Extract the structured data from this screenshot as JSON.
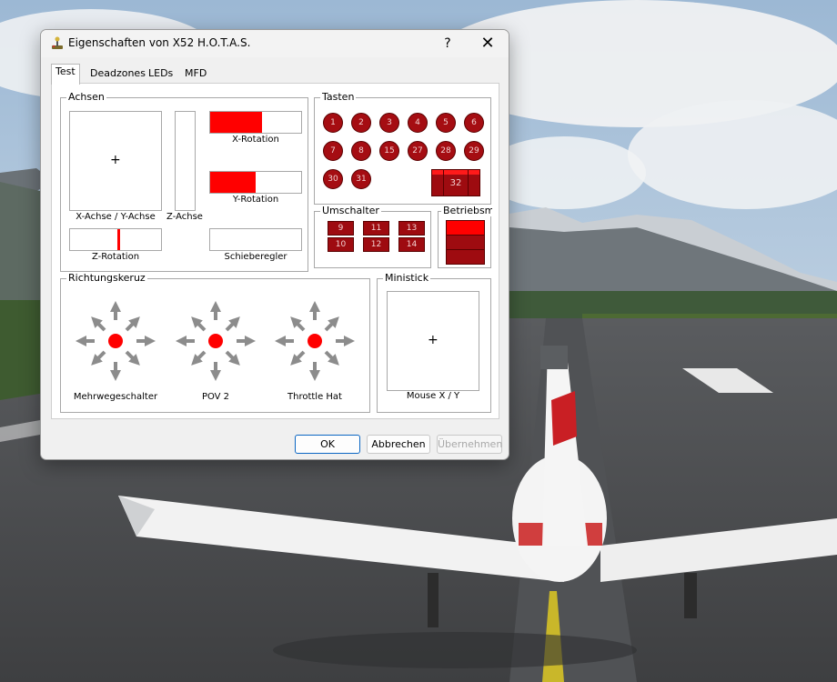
{
  "window": {
    "title": "Eigenschaften von X52 H.O.T.A.S.",
    "help_glyph": "?",
    "close_glyph": "✕"
  },
  "tabs": [
    {
      "label": "Test",
      "active": true
    },
    {
      "label": "Deadzones",
      "active": false
    },
    {
      "label": "LEDs",
      "active": false
    },
    {
      "label": "MFD",
      "active": false
    }
  ],
  "axes": {
    "group_label": "Achsen",
    "xy_label": "X-Achse / Y-Achse",
    "z_label": "Z-Achse",
    "x_rotation_label": "X-Rotation",
    "x_rotation_value": 0.57,
    "y_rotation_label": "Y-Rotation",
    "y_rotation_value": 0.5,
    "z_rotation_label": "Z-Rotation",
    "z_rotation_value": 0.52,
    "slider_label": "Schieberegler",
    "slider_value": 0,
    "crosshair_glyph": "+"
  },
  "buttons": {
    "group_label": "Tasten",
    "items": [
      "1",
      "2",
      "3",
      "4",
      "5",
      "6",
      "7",
      "8",
      "15",
      "27",
      "28",
      "29",
      "30",
      "31"
    ],
    "big_button": "32"
  },
  "switches": {
    "group_label": "Umschalter",
    "items": [
      "9",
      "11",
      "13",
      "10",
      "12",
      "14"
    ]
  },
  "mode": {
    "group_label": "Betriebsmodus",
    "active_index": 0
  },
  "hats": {
    "group_label": "Richtungskeruz",
    "items": [
      {
        "label": "Mehrwegeschalter"
      },
      {
        "label": "POV 2"
      },
      {
        "label": "Throttle Hat"
      }
    ]
  },
  "ministick": {
    "group_label": "Ministick",
    "label": "Mouse X / Y",
    "crosshair_glyph": "+"
  },
  "footer": {
    "ok": "OK",
    "cancel": "Abbrechen",
    "apply": "Übernehmen"
  },
  "colors": {
    "accent": "#0b66c3",
    "indicator_red": "#ff0000",
    "button_dark_red": "#a50d12"
  }
}
